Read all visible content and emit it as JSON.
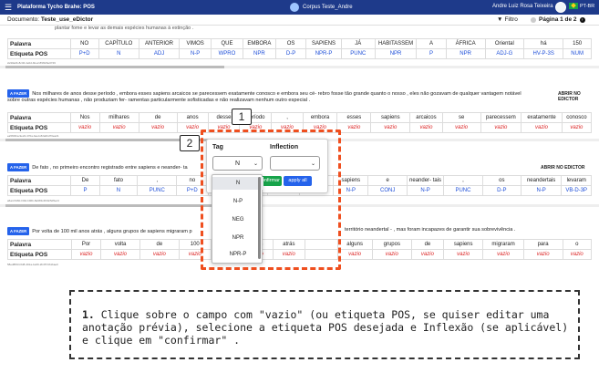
{
  "topbar": {
    "menu_icon": "hamburger-icon",
    "title": "Plataforma Tycho Brahe: POS",
    "corpus": "Corpus Teste_Andre",
    "user": "Andre Luiz Rosa Teixeira",
    "lang": "PT-BR"
  },
  "docbar": {
    "document_label": "Documento:",
    "document_name": "Teste_use_eDictor",
    "filter": "Filtro",
    "page": "Página 1 de 2"
  },
  "cut_text": "plantar fome e levar as demais espécies humanas à extinção .",
  "blocks": [
    {
      "hash": "2e90a2b-8c46-4e0d-bbe2-89f0c6e0746",
      "tokens": [
        "NO",
        "CAPÍTULO",
        "ANTERIOR",
        "VIMOS",
        "QUE",
        "EMBORA",
        "OS",
        "SAPIENS",
        "JÁ",
        "HABITASSEM",
        "A",
        "ÁFRICA",
        "Oriental",
        "há",
        "150"
      ],
      "tags": [
        "P+D",
        "N",
        "ADJ",
        "N-P",
        "WPRO",
        "NPR",
        "D-P",
        "NPR-P",
        "PUNC",
        "NPR",
        "P",
        "NPR",
        "ADJ-G",
        "HV-P-3S",
        "NUM"
      ]
    },
    {
      "fazer": "A FAZER",
      "sentence": "Nos milhares de anos desse período , embora esses sapiens arcaicos se parecessem exatamente conosco e embora seu cé- rebro fosse tão grande quanto o nosso , eles não gozavam de qualquer vantagem notável sobre outras espécies humanas , não produziam fer- ramentas particularmente sofisticadas e não realizavam nenhum outro especial .",
      "abrir": "ABRIR NO EDICTOR",
      "hash": "ea56f2ba-9e22-470a-bae4-82a0bd76ea21",
      "tokens": [
        "Nos",
        "milhares",
        "de",
        "anos",
        "desse",
        "período",
        ",",
        "embora",
        "esses",
        "sapiens",
        "arcaicos",
        "se",
        "parecessem",
        "exatamente",
        "conosco"
      ],
      "tags": [
        "vazio",
        "vazio",
        "vazio",
        "vazio",
        "vazio",
        "vazio",
        "vazio",
        "vazio",
        "vazio",
        "vazio",
        "vazio",
        "vazio",
        "vazio",
        "vazio",
        "vazio"
      ]
    },
    {
      "fazer": "A FAZER",
      "sentence": "De fato , no primeiro encontro registrado entre sapiens e neander- ta",
      "abrir": "ABRIR NO EDICTOR",
      "hash": "a6a4-5460-f4b0-b96b-8a9ff4c4f00c5d5ec3",
      "tokens": [
        "De",
        "fato",
        ",",
        "no",
        "",
        "",
        "",
        "entre",
        "sapiens",
        "e",
        "neander- tais",
        ",",
        "os",
        "neandertais",
        "levaram"
      ],
      "tags": [
        "P",
        "N",
        "PUNC",
        "P+D",
        "",
        "",
        "VB-AN",
        "P",
        "N-P",
        "CONJ",
        "N-P",
        "PUNC",
        "D-P",
        "N-P",
        "VB-D-3P"
      ]
    },
    {
      "fazer": "A FAZER",
      "sentence": "Por volta de 100 mil anos atrás , alguns grupos de sapiens migraram p",
      "sentence_tail": "território neandertal - , mas foram incapazes de garantir sua sobrevivência .",
      "hash": "58ed8f93-f2d8-491a-be09-2b4574b1bae0",
      "tokens": [
        "Por",
        "volta",
        "de",
        "100",
        "",
        "anos",
        "atrás",
        "",
        "alguns",
        "grupos",
        "de",
        "sapiens",
        "migraram",
        "para",
        "o"
      ],
      "tags": [
        "vazio",
        "vazio",
        "vazio",
        "vazio",
        "",
        "vazio",
        "vazio",
        "",
        "vazio",
        "vazio",
        "vazio",
        "vazio",
        "vazio",
        "vazio",
        "vazio"
      ]
    }
  ],
  "row_labels": {
    "word": "Palavra",
    "pos": "Etiqueta POS"
  },
  "popup": {
    "tag_label": "Tag",
    "inflection_label": "Inflection",
    "tag_value": "N",
    "confirm": "confirmar",
    "apply_all": "apply all",
    "options": [
      "N",
      "N-P",
      "NEG",
      "NPR",
      "NPR-P"
    ]
  },
  "markers": [
    "1",
    "2"
  ],
  "instruction": {
    "number": "1.",
    "text": "Clique sobre o campo com \"vazio\" (ou etiqueta POS, se quiser editar uma anotação prévia), selecione a etiqueta POS desejada e Inflexão (se aplicável) e clique em \"confirmar\" ."
  },
  "colors": {
    "topbar": "#1e3a8a",
    "highlight": "#ef4f1f",
    "vazio": "#dc2626",
    "tag": "#1d4ed8"
  }
}
